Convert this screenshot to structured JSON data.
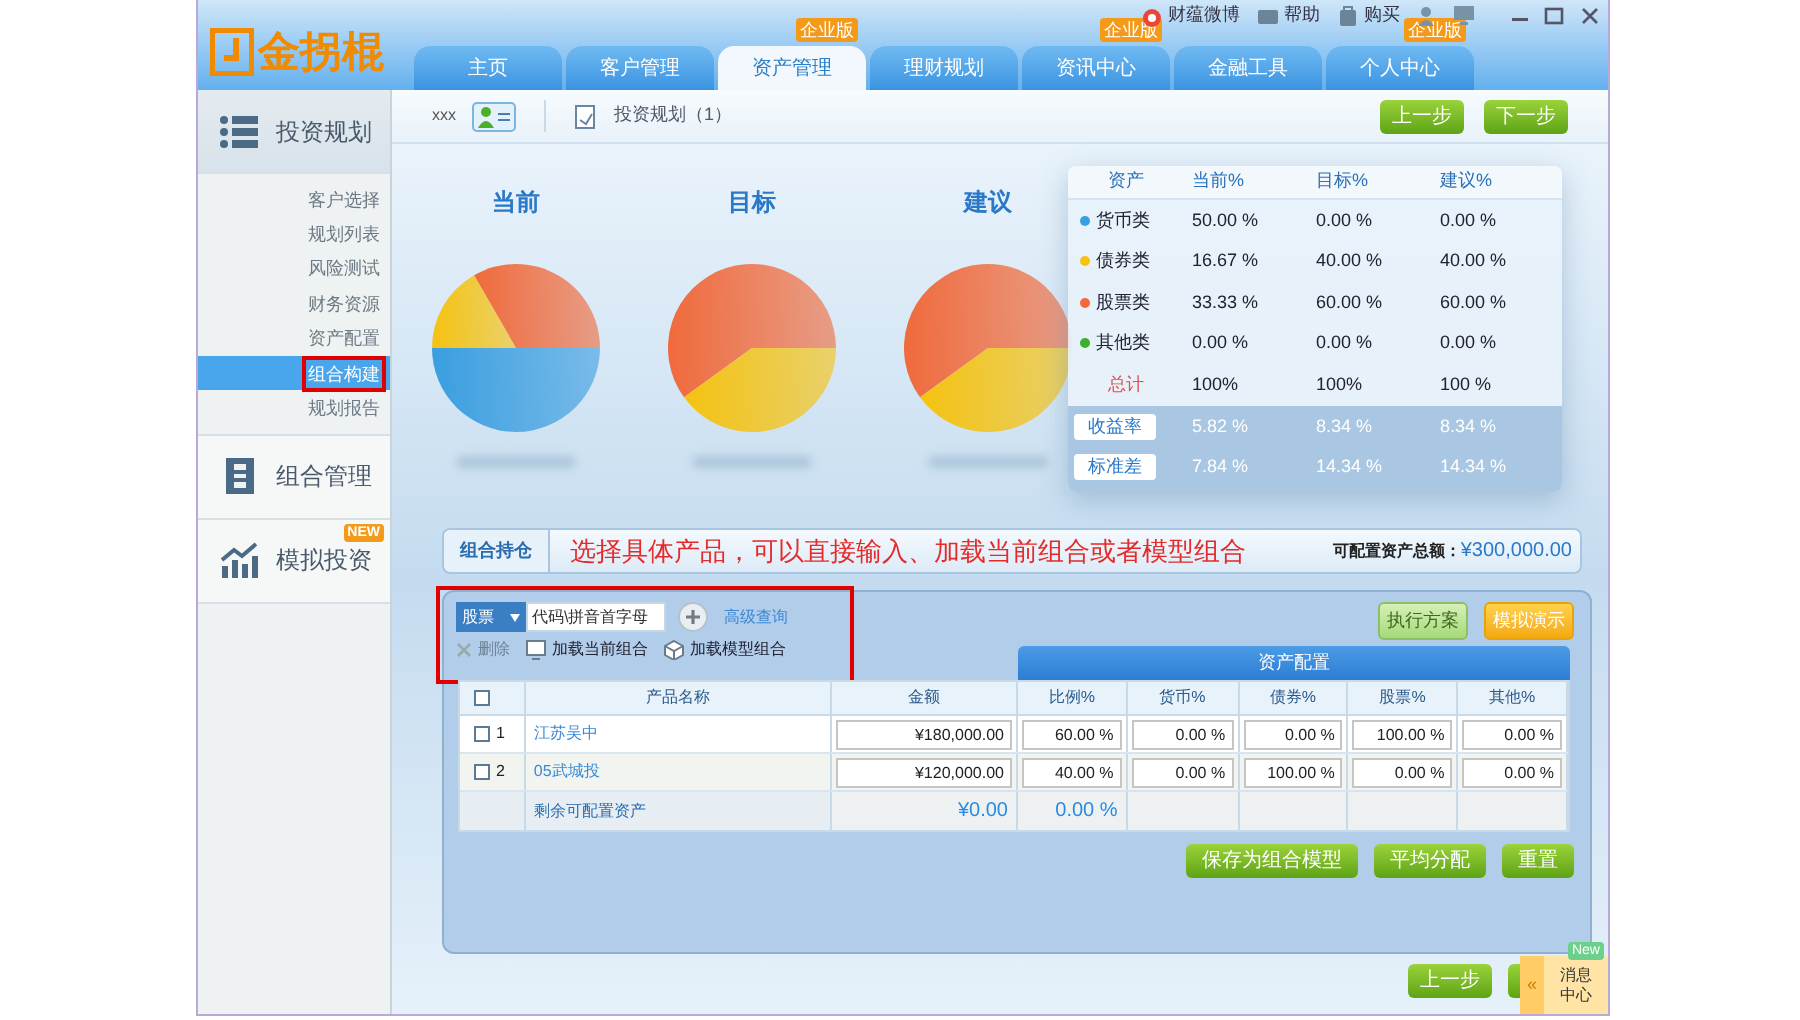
{
  "logo": {
    "text": "金拐棍"
  },
  "top_links": [
    {
      "label": "财蕴微博",
      "kind": "weibo"
    },
    {
      "label": "帮助",
      "kind": "help"
    },
    {
      "label": "购买",
      "kind": "buy"
    }
  ],
  "tabs": [
    {
      "label": "主页",
      "selected": false
    },
    {
      "label": "客户管理",
      "selected": false
    },
    {
      "label": "资产管理",
      "selected": true,
      "badge": "企业版"
    },
    {
      "label": "理财规划",
      "selected": false
    },
    {
      "label": "资讯中心",
      "selected": false,
      "badge": "企业版"
    },
    {
      "label": "金融工具",
      "selected": false
    },
    {
      "label": "个人中心",
      "selected": false,
      "badge": "企业版"
    }
  ],
  "subheader": {
    "user": "xxx",
    "breadcrumb": "投资规划（1）",
    "buttons": [
      "上一步",
      "下一步"
    ]
  },
  "sidebar": {
    "sections": [
      {
        "label": "投资规划",
        "kind": "list",
        "expanded": true,
        "children": [
          {
            "label": "客户选择",
            "selected": false,
            "highlighted": false
          },
          {
            "label": "规划列表",
            "selected": false,
            "highlighted": false
          },
          {
            "label": "风险测试",
            "selected": false,
            "highlighted": false
          },
          {
            "label": "财务资源",
            "selected": false,
            "highlighted": false
          },
          {
            "label": "资产配置",
            "selected": false,
            "highlighted": false
          },
          {
            "label": "组合构建",
            "selected": true,
            "highlighted": true
          },
          {
            "label": "规划报告",
            "selected": false,
            "highlighted": false
          }
        ]
      },
      {
        "label": "组合管理",
        "kind": "portfolio",
        "expanded": false
      },
      {
        "label": "模拟投资",
        "kind": "chart",
        "expanded": false,
        "badge": "NEW"
      }
    ]
  },
  "pie_titles": [
    "当前",
    "目标",
    "建议"
  ],
  "asset_table": {
    "columns": [
      "资产",
      "当前%",
      "目标%",
      "建议%"
    ],
    "rows": [
      {
        "name": "货币类",
        "color": "#3a9ee0",
        "values": [
          "50.00 %",
          "0.00 %",
          "0.00 %"
        ]
      },
      {
        "name": "债券类",
        "color": "#f5c210",
        "values": [
          "16.67 %",
          "40.00 %",
          "40.00 %"
        ]
      },
      {
        "name": "股票类",
        "color": "#f06a3c",
        "values": [
          "33.33 %",
          "60.00 %",
          "60.00 %"
        ]
      },
      {
        "name": "其他类",
        "color": "#3cb02c",
        "values": [
          "0.00 %",
          "0.00 %",
          "0.00 %"
        ]
      }
    ],
    "total": {
      "label": "总计",
      "values": [
        "100%",
        "100%",
        "100 %"
      ]
    },
    "metrics": [
      {
        "label": "收益率",
        "values": [
          "5.82 %",
          "8.34 %",
          "8.34 %"
        ]
      },
      {
        "label": "标准差",
        "values": [
          "7.84 %",
          "14.34 %",
          "14.34 %"
        ]
      }
    ]
  },
  "banner": {
    "tab": "组合持仓",
    "instruction": "选择具体产品，可以直接输入、加载当前组合或者模型组合",
    "total_label": "可配置资产总额：",
    "total_value": "¥300,000.00"
  },
  "toolbar": {
    "highlighted": true,
    "type_select": "股票",
    "search_placeholder": "代码\\拼音首字母",
    "advanced": "高级查询",
    "actions": [
      {
        "label": "删除",
        "kind": "delete",
        "disabled": true
      },
      {
        "label": "加载当前组合",
        "kind": "load-current",
        "disabled": false
      },
      {
        "label": "加载模型组合",
        "kind": "load-model",
        "disabled": false
      }
    ],
    "buttons": [
      {
        "label": "执行方案",
        "kind": "green"
      },
      {
        "label": "模拟演示",
        "kind": "orange"
      }
    ]
  },
  "holdings": {
    "group_header": "资产配置",
    "columns": [
      "产品名称",
      "金额",
      "比例%",
      "货币%",
      "债券%",
      "股票%",
      "其他%"
    ],
    "rows": [
      {
        "checked": false,
        "index": "1",
        "name": "江苏吴中",
        "amount": "¥180,000.00",
        "ratio": "60.00 %",
        "cash": "0.00 %",
        "bond": "0.00 %",
        "stock": "100.00 %",
        "other": "0.00 %"
      },
      {
        "checked": false,
        "index": "2",
        "name": "05武城投",
        "amount": "¥120,000.00",
        "ratio": "40.00 %",
        "cash": "0.00 %",
        "bond": "100.00 %",
        "stock": "0.00 %",
        "other": "0.00 %"
      }
    ],
    "select_all": false,
    "remaining": {
      "label": "剩余可配置资产",
      "amount": "¥0.00",
      "ratio": "0.00 %"
    }
  },
  "panel_buttons": [
    "保存为组合模型",
    "平均分配",
    "重置"
  ],
  "footer_buttons": [
    "上一步"
  ],
  "message_center": {
    "collapse": "«",
    "label": "消息中心",
    "badge": "New"
  }
}
